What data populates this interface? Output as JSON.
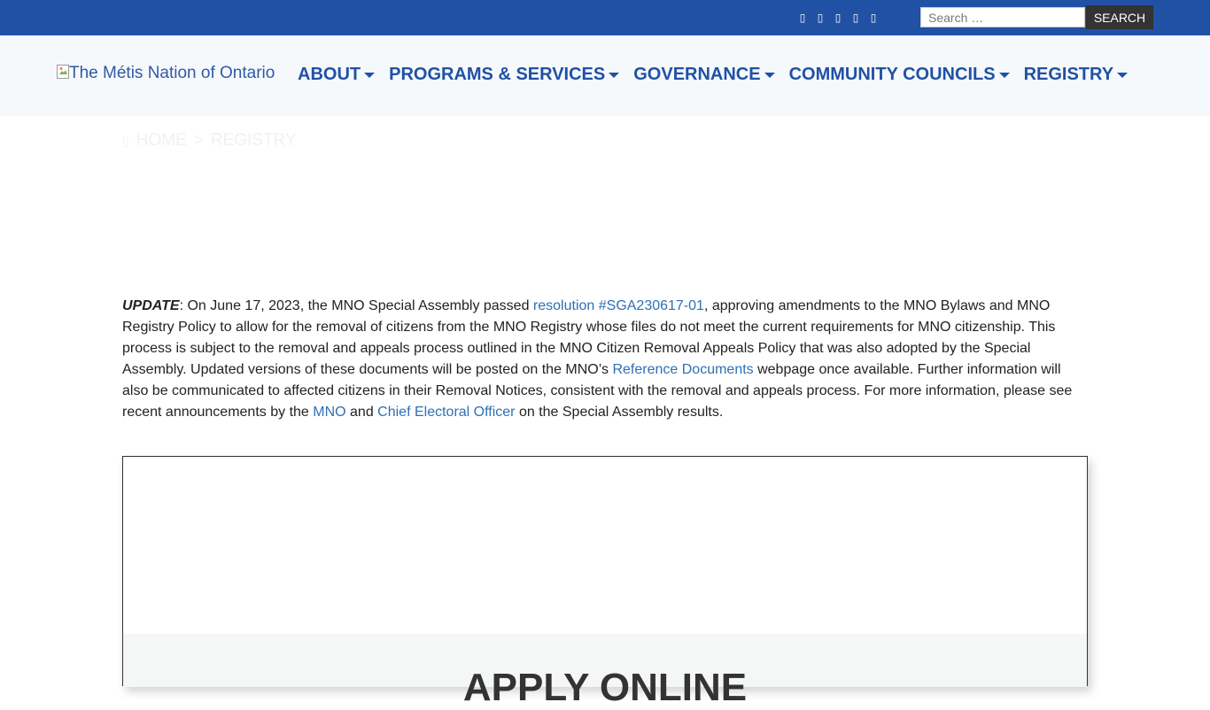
{
  "topbar": {
    "social_icons": [
      "facebook-icon",
      "twitter-icon",
      "instagram-icon",
      "youtube-icon",
      "linkedin-icon"
    ],
    "search_placeholder": "Search …",
    "search_button": "SEARCH"
  },
  "nav": {
    "logo_alt": "The Métis Nation of Ontario",
    "items": [
      {
        "label": "ABOUT"
      },
      {
        "label": "PROGRAMS & SERVICES"
      },
      {
        "label": "GOVERNANCE"
      },
      {
        "label": "COMMUNITY COUNCILS"
      },
      {
        "label": "REGISTRY"
      }
    ]
  },
  "breadcrumb": {
    "home": "HOME",
    "separator": ">",
    "current": "REGISTRY"
  },
  "update": {
    "lead": "UPDATE",
    "t1": ": On June 17, 2023, the MNO Special Assembly passed ",
    "link1": "resolution #SGA230617-01",
    "t2": ", approving amendments to the MNO Bylaws and MNO Registry Policy to allow for the removal of citizens from the MNO Registry whose files do not meet the current requirements for MNO citizenship. This process is subject to the removal and appeals process outlined in the MNO Citizen Removal Appeals Policy that was also adopted by the Special Assembly. Updated versions of these documents will be posted on the MNO’s ",
    "link2": "Reference Documents",
    "t3": " webpage once available. Further information will also be communicated to affected citizens in their Removal Notices, consistent with the removal and appeals process. For more information, please see recent announcements by the ",
    "link3": "MNO",
    "t4": " and ",
    "link4": "Chief Electoral Officer",
    "t5": " on the Special Assembly results."
  },
  "card": {
    "title": "APPLY ONLINE"
  },
  "colors": {
    "brand_blue": "#2051a4",
    "link_blue": "#2f6fb4",
    "nav_bg": "#f6f9fc"
  }
}
